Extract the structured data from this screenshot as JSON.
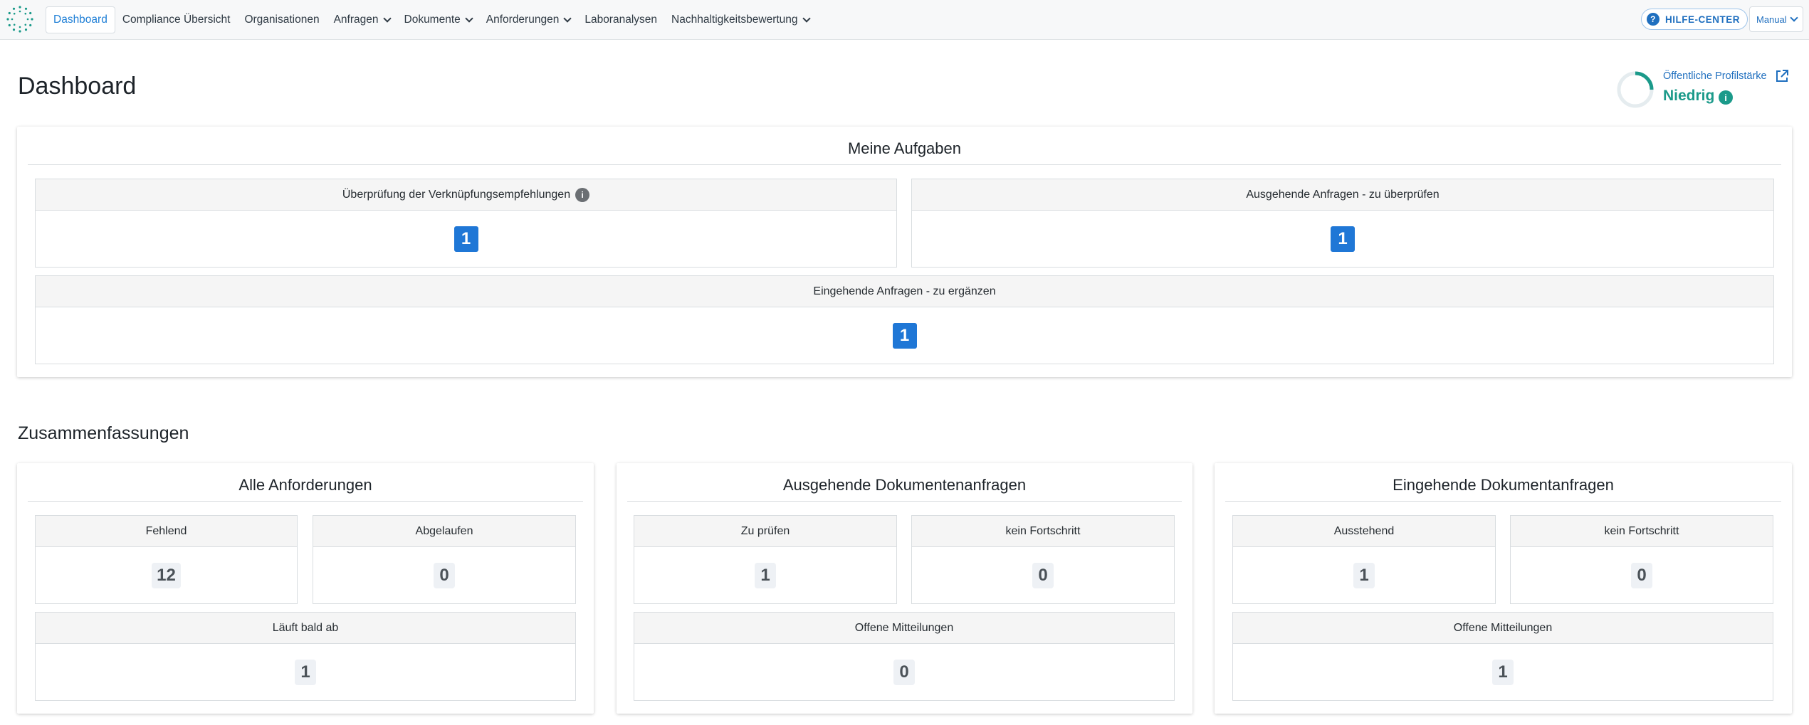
{
  "nav": {
    "items": [
      {
        "label": "Dashboard",
        "active": true,
        "dropdown": false
      },
      {
        "label": "Compliance Übersicht",
        "active": false,
        "dropdown": false
      },
      {
        "label": "Organisationen",
        "active": false,
        "dropdown": false
      },
      {
        "label": "Anfragen",
        "active": false,
        "dropdown": true
      },
      {
        "label": "Dokumente",
        "active": false,
        "dropdown": true
      },
      {
        "label": "Anforderungen",
        "active": false,
        "dropdown": true
      },
      {
        "label": "Laboranalysen",
        "active": false,
        "dropdown": false
      },
      {
        "label": "Nachhaltigkeitsbewertung",
        "active": false,
        "dropdown": true
      }
    ],
    "help_label": "HILFE-CENTER",
    "user_label": "Manual",
    "accent": "#1f7fd6"
  },
  "page": {
    "title": "Dashboard",
    "score": {
      "link_label": "Öffentliche Profilstärke",
      "level": "Niedrig",
      "progress": 0.25,
      "color": "#1b9a8a"
    }
  },
  "tasks": {
    "title": "Meine Aufgaben",
    "review_links": {
      "label": "Überprüfung der Verknüpfungsempfehlungen",
      "value": "1"
    },
    "outgoing_review": {
      "label": "Ausgehende Anfragen - zu überprüfen",
      "value": "1"
    },
    "incoming_complete": {
      "label": "Eingehende Anfragen - zu ergänzen",
      "value": "1"
    }
  },
  "summaries": {
    "title": "Zusammenfassungen",
    "requirements": {
      "title": "Alle Anforderungen",
      "missing": {
        "label": "Fehlend",
        "value": "12"
      },
      "expired": {
        "label": "Abgelaufen",
        "value": "0"
      },
      "expiring": {
        "label": "Läuft bald ab",
        "value": "1"
      }
    },
    "outgoing": {
      "title": "Ausgehende Dokumentenanfragen",
      "to_review": {
        "label": "Zu prüfen",
        "value": "1"
      },
      "no_progress": {
        "label": "kein Fortschritt",
        "value": "0"
      },
      "open_messages": {
        "label": "Offene Mitteilungen",
        "value": "0"
      }
    },
    "incoming": {
      "title": "Eingehende Dokumentanfragen",
      "pending": {
        "label": "Ausstehend",
        "value": "1"
      },
      "no_progress": {
        "label": "kein Fortschritt",
        "value": "0"
      },
      "open_messages": {
        "label": "Offene Mitteilungen",
        "value": "1"
      }
    }
  }
}
